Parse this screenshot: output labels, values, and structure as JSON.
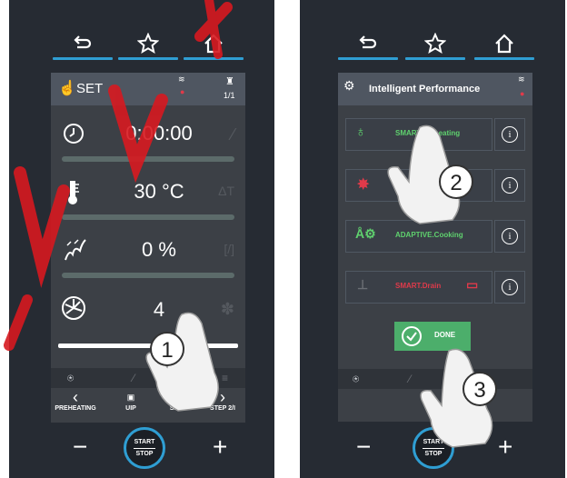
{
  "colors": {
    "accent": "#2f9ed3",
    "panel": "#262b33",
    "screen": "#3c4046",
    "watermark": "#d71920",
    "green": "#4cae6b",
    "red": "#e03a4a"
  },
  "left": {
    "header": {
      "title": "SET",
      "step": "1/1"
    },
    "rows": [
      {
        "icon": "clock-icon",
        "value": "0:00:00",
        "aside": "probe-icon"
      },
      {
        "icon": "thermometer-icon",
        "value": "30 °C",
        "aside": "ΔT"
      },
      {
        "icon": "humidity-icon",
        "value": "0 %",
        "aside": "[/]"
      },
      {
        "icon": "fan-icon",
        "value": "4",
        "aside": "fan-icon"
      }
    ],
    "slider_level": 0.45,
    "nav": [
      {
        "label": "PREHEATING",
        "icon": "‹"
      },
      {
        "label": "UIP",
        "icon": "UIP"
      },
      {
        "label": "SAVE",
        "icon": "save"
      },
      {
        "label": "STEP 2/I",
        "icon": "›"
      }
    ],
    "callout": "1"
  },
  "right": {
    "header": {
      "title": "Intelligent Performance"
    },
    "items": [
      {
        "label": "SMART.Preheating",
        "color": "#5fd16e"
      },
      {
        "label": "",
        "color": "#e03a4a"
      },
      {
        "label": "ADAPTIVE.Cooking",
        "color": "#5fd16e"
      },
      {
        "label": "SMART.Drain",
        "color": "#e03a4a"
      }
    ],
    "info_glyph": "i",
    "done_label": "DONE",
    "callouts": [
      "2",
      "3"
    ]
  },
  "controls": {
    "start": "START",
    "stop": "STOP",
    "minus": "−",
    "plus": "+"
  },
  "watermark": "V-V-U"
}
